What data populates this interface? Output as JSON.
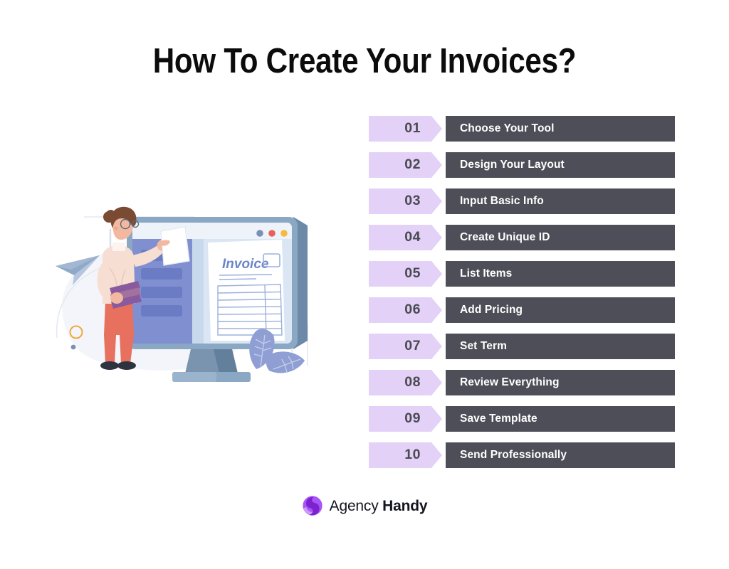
{
  "page": {
    "background_color": "#ffffff",
    "title": "How To Create Your Invoices?"
  },
  "steps": {
    "tag_color": "#e3d1f7",
    "bar_color": "#4e4e58",
    "number_color": "#4a4a52",
    "label_color": "#ffffff",
    "items": [
      {
        "number": "01",
        "label": "Choose Your Tool"
      },
      {
        "number": "02",
        "label": "Design Your Layout"
      },
      {
        "number": "03",
        "label": "Input Basic Info"
      },
      {
        "number": "04",
        "label": "Create Unique ID"
      },
      {
        "number": "05",
        "label": "List Items"
      },
      {
        "number": "06",
        "label": "Add Pricing"
      },
      {
        "number": "07",
        "label": "Set Term"
      },
      {
        "number": "08",
        "label": "Review Everything"
      },
      {
        "number": "09",
        "label": "Save Template"
      },
      {
        "number": "10",
        "label": "Send Professionally"
      }
    ]
  },
  "illustration": {
    "name": "woman-presenting-invoice-on-monitor",
    "screen_document_title": "Invoice",
    "colors": {
      "blob": "#f3f5fa",
      "monitor_bezel": "#8aa7c4",
      "monitor_frame_dark": "#6c8aa8",
      "screen_sidebar": "#7f8fd0",
      "screen_sidebar_item": "#6b7cc4",
      "screen_body": "#dbe6f4",
      "paper": "#ffffff",
      "invoice_text": "#6d86c9",
      "skin": "#f2b9a0",
      "hair": "#7b4a33",
      "sweater": "#f7ded2",
      "pants": "#e8705f",
      "shoes": "#2f3340",
      "books": "#8a5a9e",
      "leaf": "#8f9fd4",
      "plane": "#8fa9c9",
      "circle_outline": "#f0a840",
      "dot": "#8aa0c8",
      "dot_blue": "#7b8fb8",
      "dot_red": "#e8615c",
      "dot_yellow": "#f5b944"
    }
  },
  "logo": {
    "mark_name": "agency-handy-logo-mark",
    "mark_color_light": "#a855f7",
    "mark_color_dark": "#7c22ce",
    "text_light": "Agency",
    "text_bold": "Handy"
  }
}
